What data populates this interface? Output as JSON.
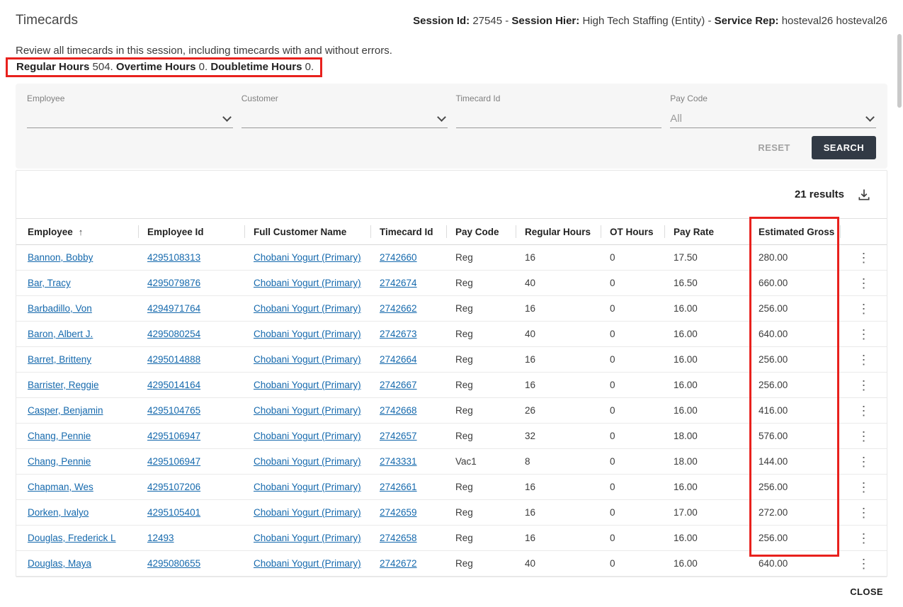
{
  "colors": {
    "link": "#1569ad",
    "highlight": "#e8211d",
    "button": "#323a45"
  },
  "header": {
    "title": "Timecards",
    "session": {
      "separator": " - ",
      "parts": [
        {
          "label": "Session Id:",
          "value": "27545"
        },
        {
          "label": "Session Hier:",
          "value": "High Tech Staffing (Entity)"
        },
        {
          "label": "Service Rep:",
          "value": "hosteval26 hosteval26"
        }
      ]
    }
  },
  "intro": "Review all timecards in this session, including timecards with and without errors.",
  "summary": {
    "items": [
      {
        "label": "Regular Hours",
        "value": "504."
      },
      {
        "label": "Overtime Hours",
        "value": "0."
      },
      {
        "label": "Doubletime Hours",
        "value": "0."
      }
    ]
  },
  "filters": {
    "fields": [
      {
        "label": "Employee",
        "value": "",
        "type": "select"
      },
      {
        "label": "Customer",
        "value": "",
        "type": "select"
      },
      {
        "label": "Timecard Id",
        "value": "",
        "type": "text"
      },
      {
        "label": "Pay Code",
        "value": "All",
        "type": "select"
      }
    ],
    "reset_label": "RESET",
    "search_label": "SEARCH"
  },
  "results": {
    "count": "21 results",
    "columns": [
      "Employee",
      "Employee Id",
      "Full Customer Name",
      "Timecard Id",
      "Pay Code",
      "Regular Hours",
      "OT Hours",
      "Pay Rate",
      "Estimated Gross"
    ],
    "rows": [
      {
        "employee": "Bannon, Bobby",
        "employee_id": "4295108313",
        "customer": "Chobani Yogurt (Primary)",
        "timecard_id": "2742660",
        "pay_code": "Reg",
        "regular_hours": "16",
        "ot_hours": "0",
        "pay_rate": "17.50",
        "estimated_gross": "280.00"
      },
      {
        "employee": "Bar, Tracy",
        "employee_id": "4295079876",
        "customer": "Chobani Yogurt (Primary)",
        "timecard_id": "2742674",
        "pay_code": "Reg",
        "regular_hours": "40",
        "ot_hours": "0",
        "pay_rate": "16.50",
        "estimated_gross": "660.00"
      },
      {
        "employee": "Barbadillo, Von",
        "employee_id": "4294971764",
        "customer": "Chobani Yogurt (Primary)",
        "timecard_id": "2742662",
        "pay_code": "Reg",
        "regular_hours": "16",
        "ot_hours": "0",
        "pay_rate": "16.00",
        "estimated_gross": "256.00"
      },
      {
        "employee": "Baron, Albert J.",
        "employee_id": "4295080254",
        "customer": "Chobani Yogurt (Primary)",
        "timecard_id": "2742673",
        "pay_code": "Reg",
        "regular_hours": "40",
        "ot_hours": "0",
        "pay_rate": "16.00",
        "estimated_gross": "640.00"
      },
      {
        "employee": "Barret, Britteny",
        "employee_id": "4295014888",
        "customer": "Chobani Yogurt (Primary)",
        "timecard_id": "2742664",
        "pay_code": "Reg",
        "regular_hours": "16",
        "ot_hours": "0",
        "pay_rate": "16.00",
        "estimated_gross": "256.00"
      },
      {
        "employee": "Barrister, Reggie",
        "employee_id": "4295014164",
        "customer": "Chobani Yogurt (Primary)",
        "timecard_id": "2742667",
        "pay_code": "Reg",
        "regular_hours": "16",
        "ot_hours": "0",
        "pay_rate": "16.00",
        "estimated_gross": "256.00"
      },
      {
        "employee": "Casper, Benjamin",
        "employee_id": "4295104765",
        "customer": "Chobani Yogurt (Primary)",
        "timecard_id": "2742668",
        "pay_code": "Reg",
        "regular_hours": "26",
        "ot_hours": "0",
        "pay_rate": "16.00",
        "estimated_gross": "416.00"
      },
      {
        "employee": "Chang, Pennie",
        "employee_id": "4295106947",
        "customer": "Chobani Yogurt (Primary)",
        "timecard_id": "2742657",
        "pay_code": "Reg",
        "regular_hours": "32",
        "ot_hours": "0",
        "pay_rate": "18.00",
        "estimated_gross": "576.00"
      },
      {
        "employee": "Chang, Pennie",
        "employee_id": "4295106947",
        "customer": "Chobani Yogurt (Primary)",
        "timecard_id": "2743331",
        "pay_code": "Vac1",
        "regular_hours": "8",
        "ot_hours": "0",
        "pay_rate": "18.00",
        "estimated_gross": "144.00"
      },
      {
        "employee": "Chapman, Wes",
        "employee_id": "4295107206",
        "customer": "Chobani Yogurt (Primary)",
        "timecard_id": "2742661",
        "pay_code": "Reg",
        "regular_hours": "16",
        "ot_hours": "0",
        "pay_rate": "16.00",
        "estimated_gross": "256.00"
      },
      {
        "employee": "Dorken, Ivalyo",
        "employee_id": "4295105401",
        "customer": "Chobani Yogurt (Primary)",
        "timecard_id": "2742659",
        "pay_code": "Reg",
        "regular_hours": "16",
        "ot_hours": "0",
        "pay_rate": "17.00",
        "estimated_gross": "272.00"
      },
      {
        "employee": "Douglas, Frederick L",
        "employee_id": "12493",
        "customer": "Chobani Yogurt (Primary)",
        "timecard_id": "2742658",
        "pay_code": "Reg",
        "regular_hours": "16",
        "ot_hours": "0",
        "pay_rate": "16.00",
        "estimated_gross": "256.00"
      },
      {
        "employee": "Douglas, Maya",
        "employee_id": "4295080655",
        "customer": "Chobani Yogurt (Primary)",
        "timecard_id": "2742672",
        "pay_code": "Reg",
        "regular_hours": "40",
        "ot_hours": "0",
        "pay_rate": "16.00",
        "estimated_gross": "640.00"
      }
    ]
  },
  "icons": {
    "sort_asc": "↑",
    "kebab": "⋮"
  },
  "footer": {
    "close_label": "CLOSE"
  }
}
